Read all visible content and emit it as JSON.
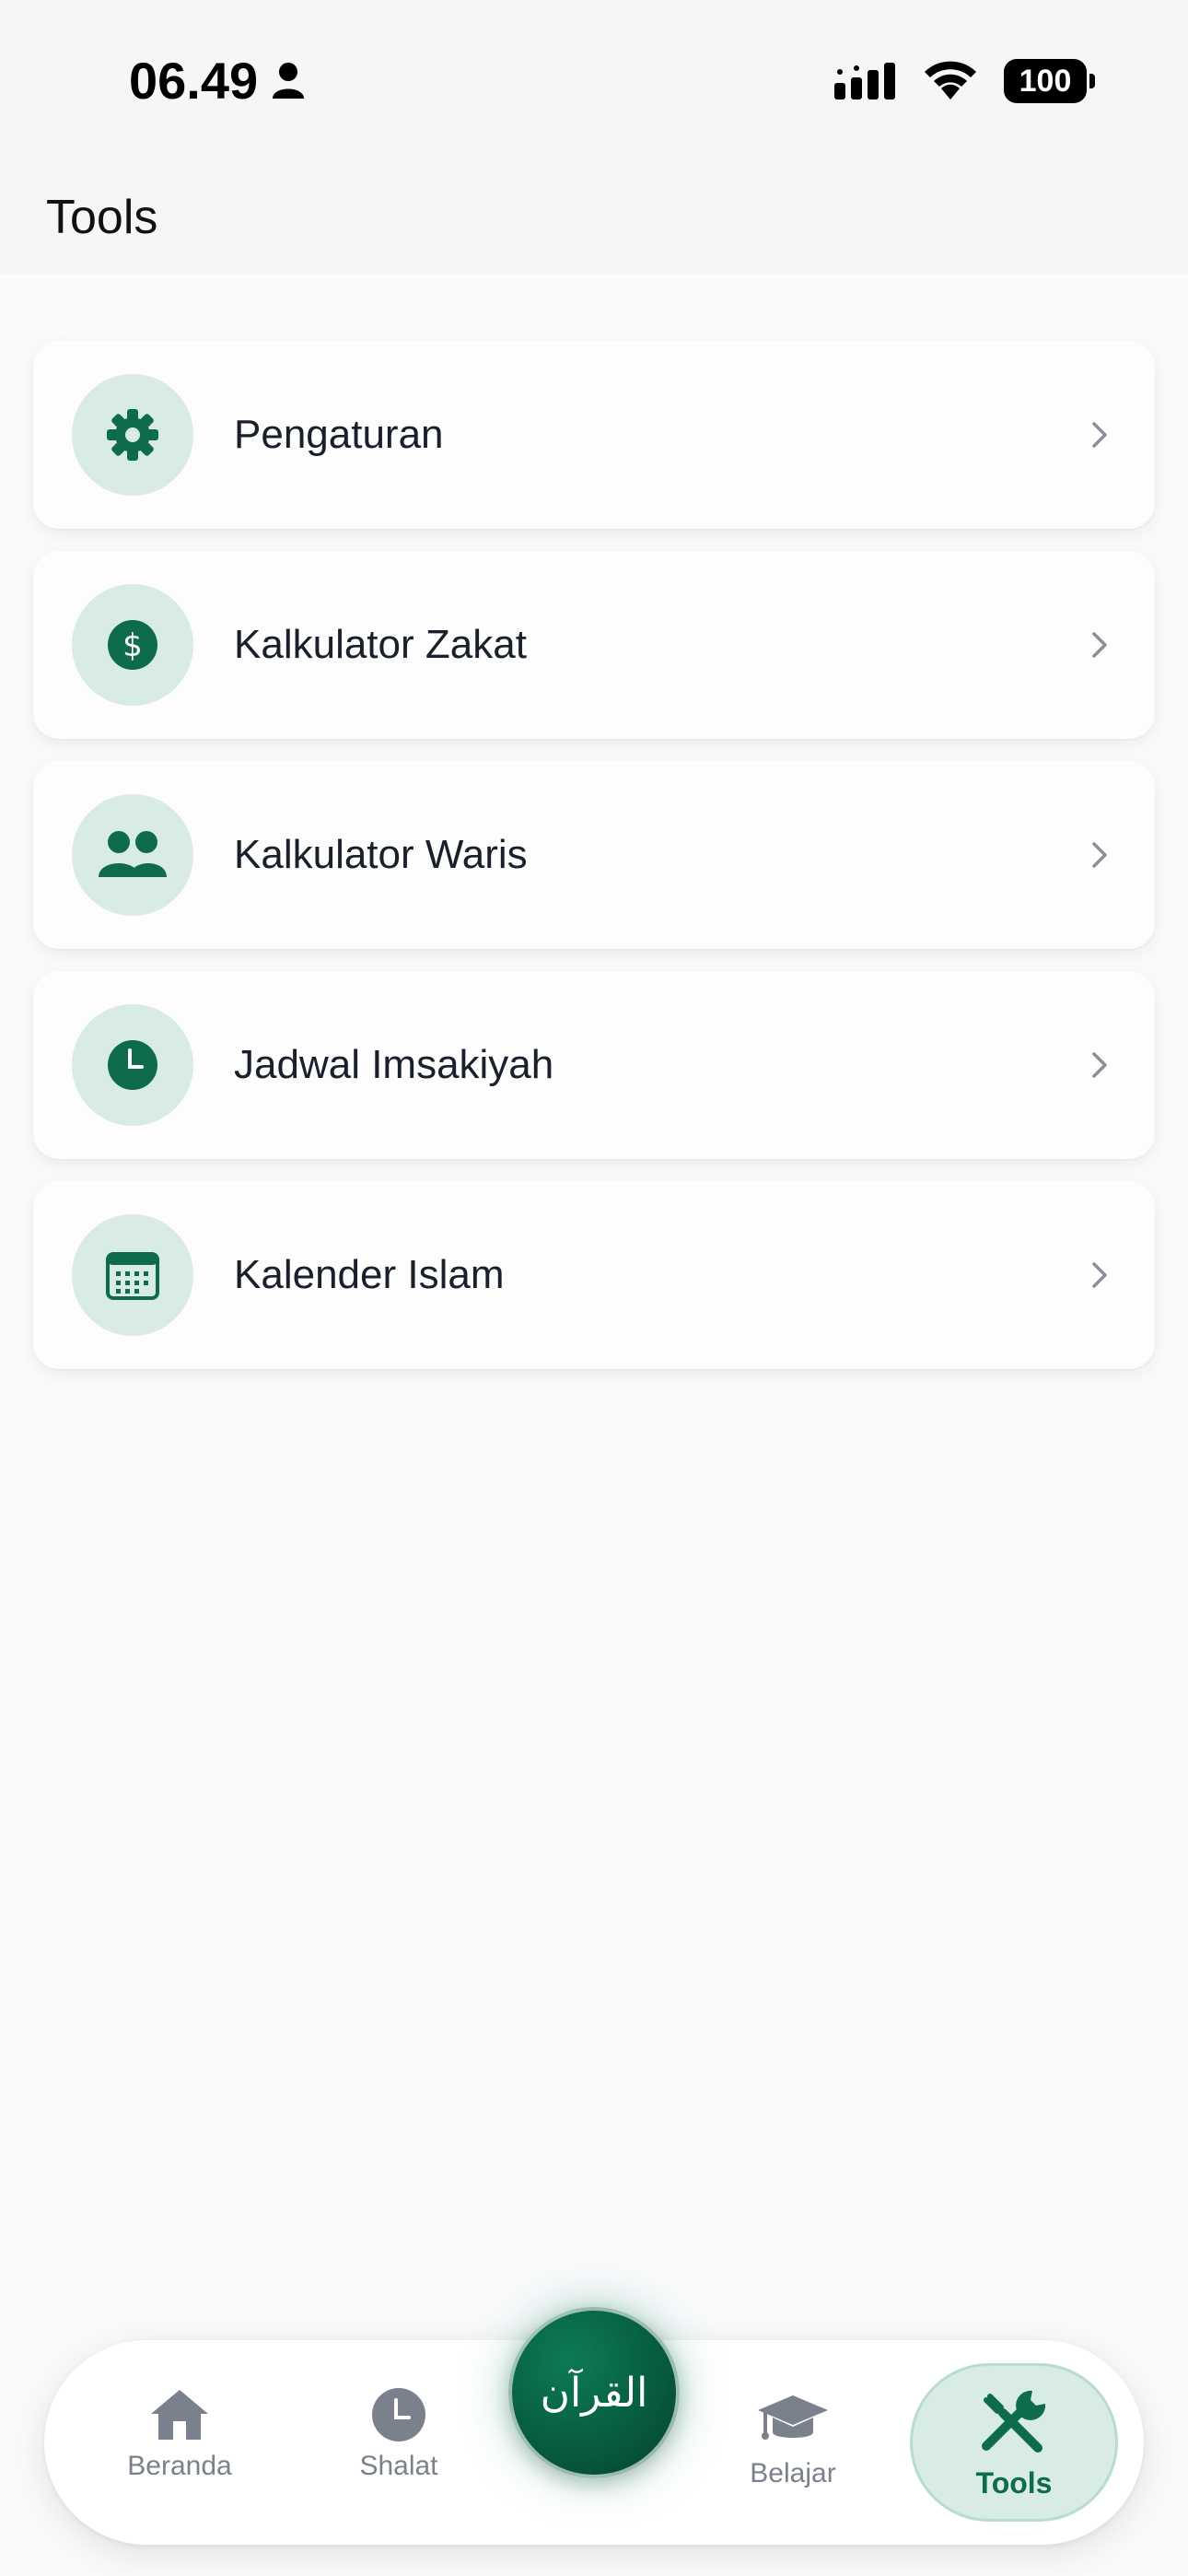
{
  "status": {
    "time": "06.49",
    "battery": "100"
  },
  "header": {
    "title": "Tools"
  },
  "menu": [
    {
      "label": "Pengaturan",
      "icon": "gear-icon"
    },
    {
      "label": "Kalkulator Zakat",
      "icon": "dollar-icon"
    },
    {
      "label": "Kalkulator Waris",
      "icon": "users-icon"
    },
    {
      "label": "Jadwal Imsakiyah",
      "icon": "clock-icon"
    },
    {
      "label": "Kalender Islam",
      "icon": "calendar-icon"
    }
  ],
  "nav": {
    "beranda": "Beranda",
    "shalat": "Shalat",
    "quran": "القرآن",
    "belajar": "Belajar",
    "tools": "Tools"
  },
  "colors": {
    "accent": "#0e6b4c",
    "icon_bg": "#d8ebe5",
    "text": "#1a1f2c",
    "muted": "#7a808c"
  }
}
